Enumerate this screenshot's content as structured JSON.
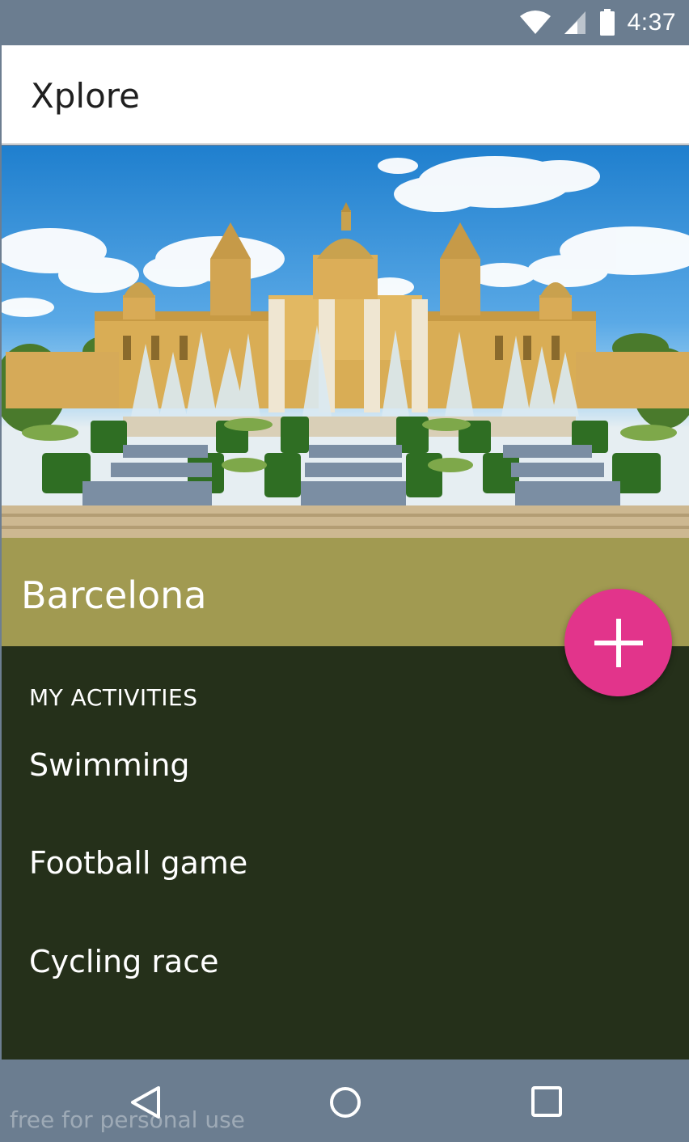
{
  "status_bar": {
    "time": "4:37",
    "icons": [
      "wifi-icon",
      "cell-signal-icon",
      "battery-icon"
    ]
  },
  "app_bar": {
    "title": "Xplore"
  },
  "hero": {
    "image": "barcelona-palace-fountain-photo"
  },
  "city": {
    "name": "Barcelona",
    "band_color": "#a19a51"
  },
  "activities": {
    "header": "MY ACTIVITIES",
    "items": [
      {
        "label": "Swimming"
      },
      {
        "label": "Football game"
      },
      {
        "label": "Cycling race"
      }
    ],
    "background_color": "#25301a"
  },
  "fab": {
    "icon": "plus-icon",
    "color": "#e2348b"
  },
  "nav_bar": {
    "icons": [
      "back-icon",
      "home-icon",
      "recents-icon"
    ]
  },
  "watermark": "free for personal use"
}
